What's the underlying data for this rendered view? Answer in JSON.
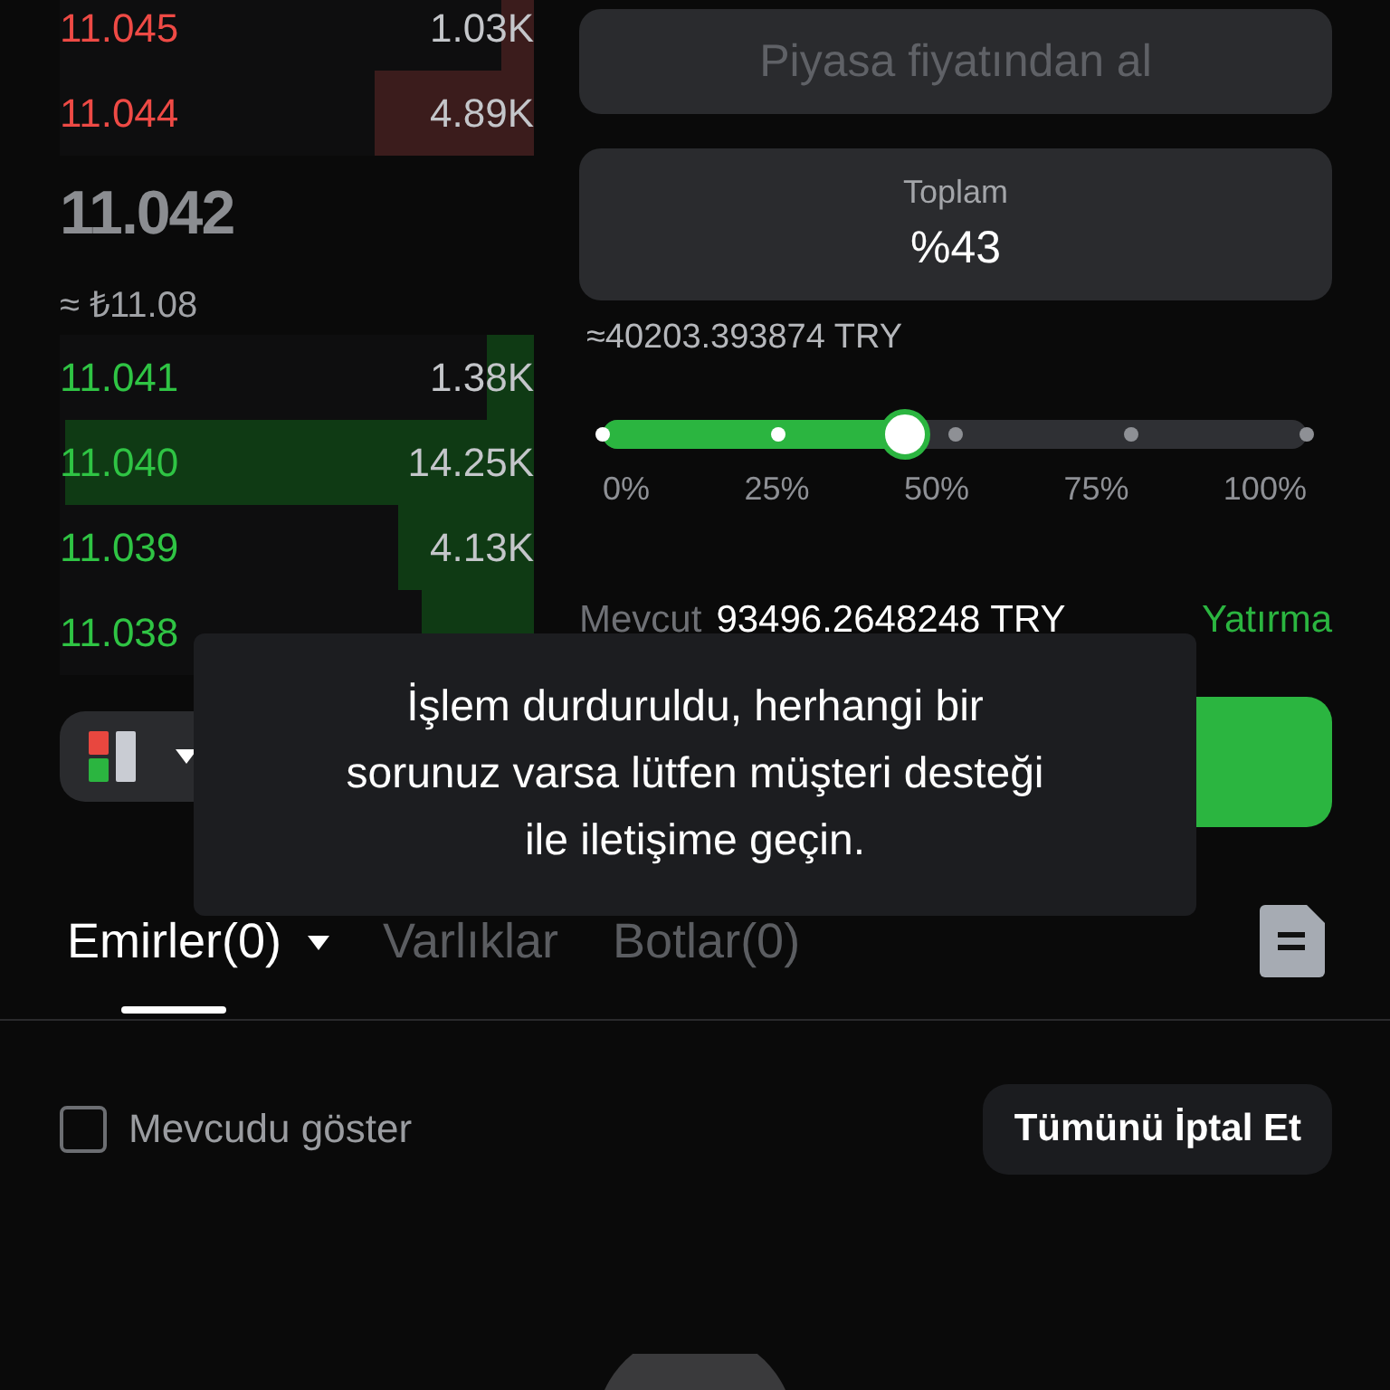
{
  "order_book": {
    "asks": [
      {
        "price": "11.045",
        "amount": "1.03K",
        "level": 0.07
      },
      {
        "price": "11.044",
        "amount": "4.89K",
        "level": 0.34
      }
    ],
    "last_price": "11.042",
    "fiat_price": "≈ ₺11.08",
    "bids": [
      {
        "price": "11.041",
        "amount": "1.38K",
        "level": 0.1
      },
      {
        "price": "11.040",
        "amount": "14.25K",
        "level": 1.0
      },
      {
        "price": "11.039",
        "amount": "4.13K",
        "level": 0.29
      },
      {
        "price": "11.038",
        "level": 0.24
      }
    ]
  },
  "order_form": {
    "market_button": {
      "label": "Piyasa fiyatından al",
      "disabled": true
    },
    "total": {
      "label": "Toplam",
      "value": "%43"
    },
    "estimate": "≈40203.393874 TRY",
    "slider": {
      "level": 0.43,
      "marks": [
        "0%",
        "25%",
        "50%",
        "75%",
        "100%"
      ]
    },
    "available": {
      "label": "Mevcut",
      "value": "93496.2648248 TRY",
      "link": "Yatırma"
    }
  },
  "toast": {
    "message": "İşlem durduruldu, herhangi bir sorunuz varsa lütfen müşteri desteği ile iletişime geçin."
  },
  "tabs": [
    {
      "label": "Emirler(0)",
      "selected": true,
      "dropdown": true
    },
    {
      "label": "Varlıklar",
      "selected": false
    },
    {
      "label": "Botlar(0)",
      "selected": false
    }
  ],
  "show_available": {
    "label": "Mevcudu göster",
    "checked": false
  },
  "cancel_all_button": "Tümünü İptal Et"
}
